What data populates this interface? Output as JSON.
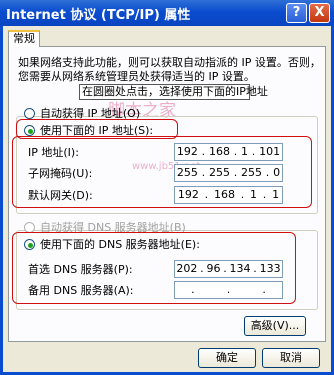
{
  "window": {
    "title": "Internet 协议 (TCP/IP) 属性",
    "help_label": "?",
    "close_label": "X"
  },
  "tab": {
    "label": "常规"
  },
  "description": [
    "如果网络支持此功能，则可以获取自动指派的 IP 设置。否则，",
    "您需要从网络系统管理员处获得适当的 IP 设置。"
  ],
  "ip": {
    "auto_label": "自动获得 IP 地址(O)",
    "manual_label": "使用下面的 IP 地址(S):",
    "ip_address": {
      "label": "IP 地址(I):",
      "value": [
        "192",
        "168",
        "1",
        "101"
      ]
    },
    "subnet_mask": {
      "label": "子网掩码(U):",
      "value": [
        "255",
        "255",
        "255",
        "0"
      ]
    },
    "gateway": {
      "label": "默认网关(D):",
      "value": [
        "192",
        "168",
        "1",
        "1"
      ]
    }
  },
  "dns": {
    "auto_label": "自动获得 DNS 服务器地址(B)",
    "manual_label": "使用下面的 DNS 服务器地址(E):",
    "preferred": {
      "label": "首选 DNS 服务器(P):",
      "value": [
        "202",
        "96",
        "134",
        "133"
      ]
    },
    "alternate": {
      "label": "备用 DNS 服务器(A):",
      "value": [
        ".",
        ".",
        "."
      ]
    }
  },
  "annotation": {
    "callout": "在圆圈处点击，选择使用下面的IP地址"
  },
  "watermark": {
    "text1": "脚本之家",
    "text2": "www.jb51.net"
  },
  "buttons": {
    "advanced": "高级(V)...",
    "ok": "确定",
    "cancel": "取消"
  },
  "colors": {
    "titlebar": "#0a4ccf",
    "annotation_red": "#d01010",
    "radio_dot": "#21a121"
  }
}
